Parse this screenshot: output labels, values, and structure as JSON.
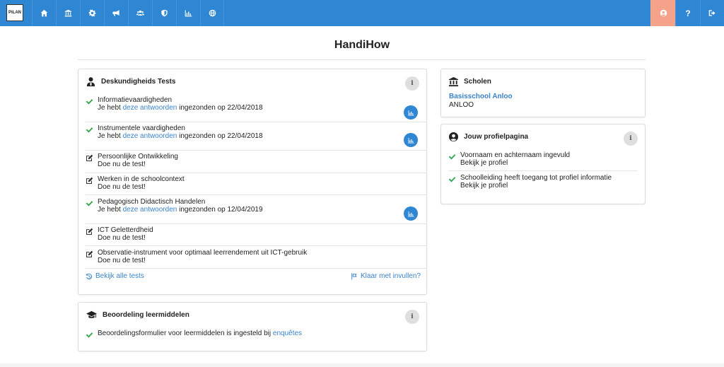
{
  "nav": {
    "logo_text": "PiLAN",
    "icons": [
      "home-icon",
      "institution-icon",
      "cogs-icon",
      "bullhorn-icon",
      "users-icon",
      "shield-icon",
      "bar-chart-icon",
      "globe-icon"
    ],
    "right_icons": [
      "user-circle-icon",
      "question-icon",
      "sign-out-icon"
    ],
    "help_glyph": "?",
    "profile_color": "#f5a28a",
    "bar_color": "#2f86d3"
  },
  "page": {
    "title": "HandiHow"
  },
  "tests_card": {
    "title": "Deskundigheids Tests",
    "info_glyph": "i",
    "rows": [
      {
        "title": "Informatievaardigheden",
        "status": "done",
        "prefix": "Je hebt ",
        "link": "deze antwoorden",
        "suffix": " ingezonden op 22/04/2018"
      },
      {
        "title": "Instrumentele vaardigheden",
        "status": "done",
        "prefix": "Je hebt ",
        "link": "deze antwoorden",
        "suffix": " ingezonden op 22/04/2018"
      },
      {
        "title": "Persoonlijke Ontwikkeling",
        "status": "todo",
        "link": "Doe nu de test!"
      },
      {
        "title": "Werken in de schoolcontext",
        "status": "todo",
        "link": "Doe nu de test!"
      },
      {
        "title": "Pedagogisch Didactisch Handelen",
        "status": "done",
        "prefix": "Je hebt ",
        "link": "deze antwoorden",
        "suffix": " ingezonden op 12/04/2019"
      },
      {
        "title": "ICT Geletterdheid",
        "status": "todo",
        "link": "Doe nu de test!"
      },
      {
        "title": "Observatie-instrument voor optimaal leerrendement uit ICT-gebruik",
        "status": "todo",
        "link": "Doe nu de test!"
      }
    ],
    "all_tests_link": "Bekijk alle tests",
    "done_link": "Klaar met invullen?"
  },
  "review_card": {
    "title": "Beoordeling leermiddelen",
    "info_glyph": "i",
    "text": "Beoordelingsformulier voor leermiddelen is ingesteld bij ",
    "link": "enquêtes"
  },
  "schools_card": {
    "title": "Scholen",
    "school_name": "Basisschool Anloo",
    "school_place": "ANLOO"
  },
  "profile_card": {
    "title": "Jouw profielpagina",
    "info_glyph": "i",
    "items": [
      {
        "text": "Voornaam en achternaam ingevuld",
        "link": "Bekijk je profiel"
      },
      {
        "text": "Schoolleiding heeft toegang tot profiel informatie",
        "link": "Bekijk je profiel"
      }
    ]
  },
  "colors": {
    "accent": "#2f86d3",
    "link": "#3a83c9",
    "check": "#3aa856"
  }
}
